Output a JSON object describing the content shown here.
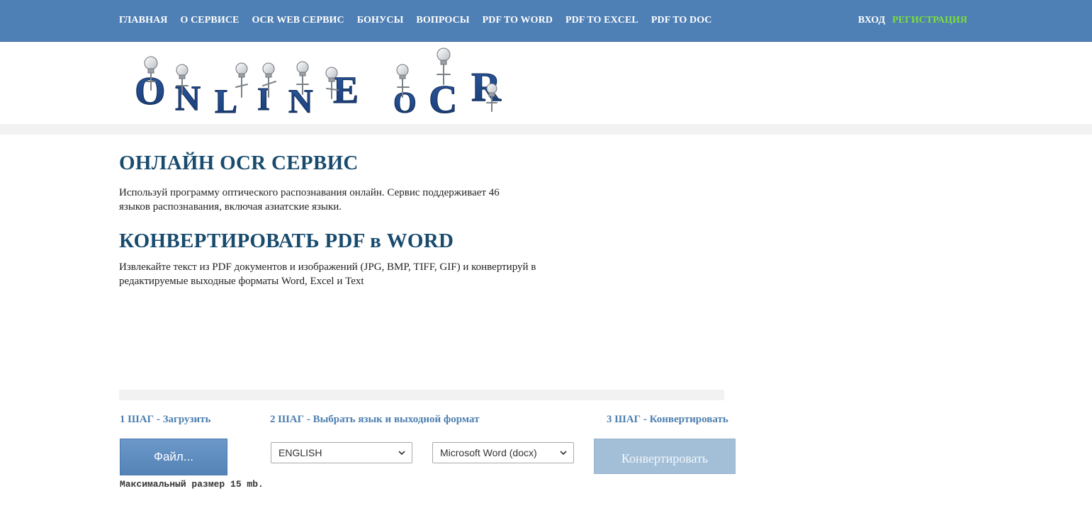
{
  "nav": {
    "items": [
      {
        "label": "ГЛАВНАЯ"
      },
      {
        "label": "О СЕРВИСЕ"
      },
      {
        "label": "OCR WEB СЕРВИС"
      },
      {
        "label": "БОНУСЫ"
      },
      {
        "label": "ВОПРОСЫ"
      },
      {
        "label": "PDF TO WORD"
      },
      {
        "label": "PDF TO EXCEL"
      },
      {
        "label": "PDF TO DOC"
      }
    ],
    "login": "ВХОД",
    "register": "РЕГИСТРАЦИЯ"
  },
  "logo": {
    "letters": [
      "O",
      "N",
      "L",
      "I",
      "N",
      "E",
      "O",
      "C",
      "R"
    ],
    "text_color": "#1f4a8c"
  },
  "main": {
    "title": "ОНЛАЙН OCR СЕРВИС",
    "description": "Используй программу оптического распознавания онлайн. Сервис поддерживает 46 языков распознавания, включая азиатские языки.",
    "title2": "КОНВЕРТИРОВАТЬ PDF в WORD",
    "description2": "Извлекайте текст из PDF документов и изображений (JPG, BMP, TIFF, GIF) и конвертируй в редактируемые выходные форматы Word, Excel и Text"
  },
  "steps": {
    "step1": "1 ШАГ - Загрузить",
    "step2": "2 ШАГ - Выбрать язык и выходной формат",
    "step3": "3 ШАГ - Конвертировать",
    "file_button": "Файл...",
    "max_size": "Максимальный размер 15 mb.",
    "language_selected": "ENGLISH",
    "format_selected": "Microsoft Word (docx)",
    "convert_button": "Конвертировать"
  },
  "colors": {
    "topbar": "#4e7fb5",
    "register": "#7dde3c",
    "heading": "#184b6e",
    "step_label": "#4d7fb0"
  }
}
